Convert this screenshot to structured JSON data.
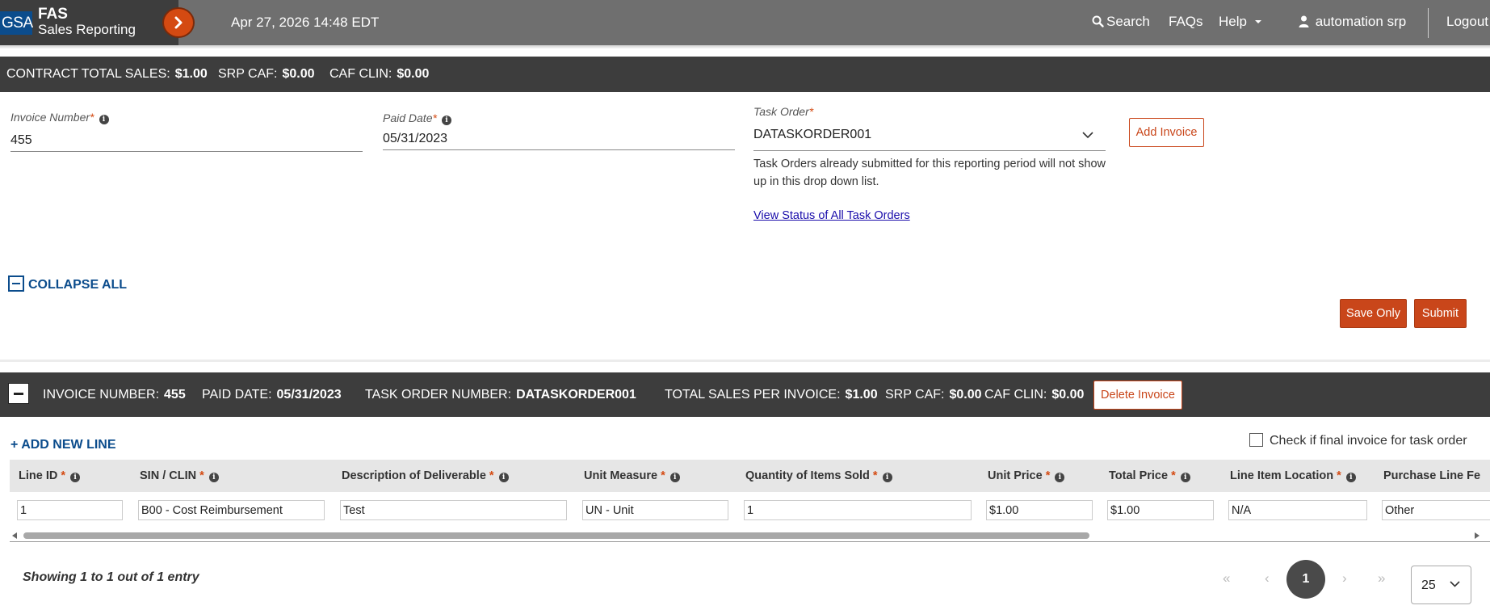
{
  "header": {
    "logo_text": "GSA",
    "app_title": "FAS",
    "app_subtitle": "Sales Reporting",
    "datetime": "Apr 27, 2026 14:48 EDT",
    "nav": {
      "search": "Search",
      "faqs": "FAQs",
      "help": "Help",
      "user": "automation srp",
      "logout": "Logout"
    }
  },
  "totals": {
    "contract_total_label": "CONTRACT TOTAL SALES:",
    "contract_total_value": "$1.00",
    "srp_caf_label": "SRP CAF:",
    "srp_caf_value": "$0.00",
    "caf_clin_label": "CAF CLIN:",
    "caf_clin_value": "$0.00"
  },
  "form": {
    "invoice_number_label": "Invoice Number",
    "invoice_number_value": "455",
    "paid_date_label": "Paid Date",
    "paid_date_value": "05/31/2023",
    "task_order_label": "Task Order",
    "task_order_value": "DATASKORDER001",
    "task_order_help": "Task Orders already submitted for this reporting period will not show up in this drop down list.",
    "view_status_link": "View Status of All Task Orders",
    "add_invoice_button": "Add Invoice",
    "required_marker": "*"
  },
  "actions": {
    "collapse_all": "COLLAPSE ALL",
    "save_only": "Save Only",
    "submit": "Submit"
  },
  "invoice": {
    "invoice_number_label": "INVOICE NUMBER:",
    "invoice_number_value": "455",
    "paid_date_label": "PAID DATE:",
    "paid_date_value": "05/31/2023",
    "task_order_label": "TASK ORDER NUMBER:",
    "task_order_value": "DATASKORDER001",
    "total_sales_label": "TOTAL SALES PER INVOICE:",
    "total_sales_value": "$1.00",
    "srp_caf_label": "SRP CAF:",
    "srp_caf_value": "$0.00",
    "caf_clin_label": "CAF CLIN:",
    "caf_clin_value": "$0.00",
    "delete_button": "Delete Invoice",
    "add_new_line": "+ ADD NEW LINE",
    "final_invoice_checkbox": "Check if final invoice for task order",
    "final_invoice_checked": false
  },
  "table": {
    "columns": [
      "Line ID",
      "SIN / CLIN",
      "Description of Deliverable",
      "Unit Measure",
      "Quantity of Items Sold",
      "Unit Price",
      "Total Price",
      "Line Item Location",
      "Purchase Line Fe"
    ],
    "rows": [
      [
        "1",
        "B00 - Cost Reimbursement",
        "Test",
        "UN - Unit",
        "1",
        "$1.00",
        "$1.00",
        "N/A",
        "Other"
      ]
    ]
  },
  "pagination": {
    "showing": "Showing 1 to 1 out of 1 entry",
    "first": "«",
    "prev": "‹",
    "current_page": "1",
    "next": "›",
    "last": "»",
    "page_size": "25"
  },
  "colors": {
    "accent": "#c9461a",
    "nav_bg": "#6f6f6f",
    "dark_bar": "#3d3d3d",
    "link_blue": "#0b4c8c"
  }
}
